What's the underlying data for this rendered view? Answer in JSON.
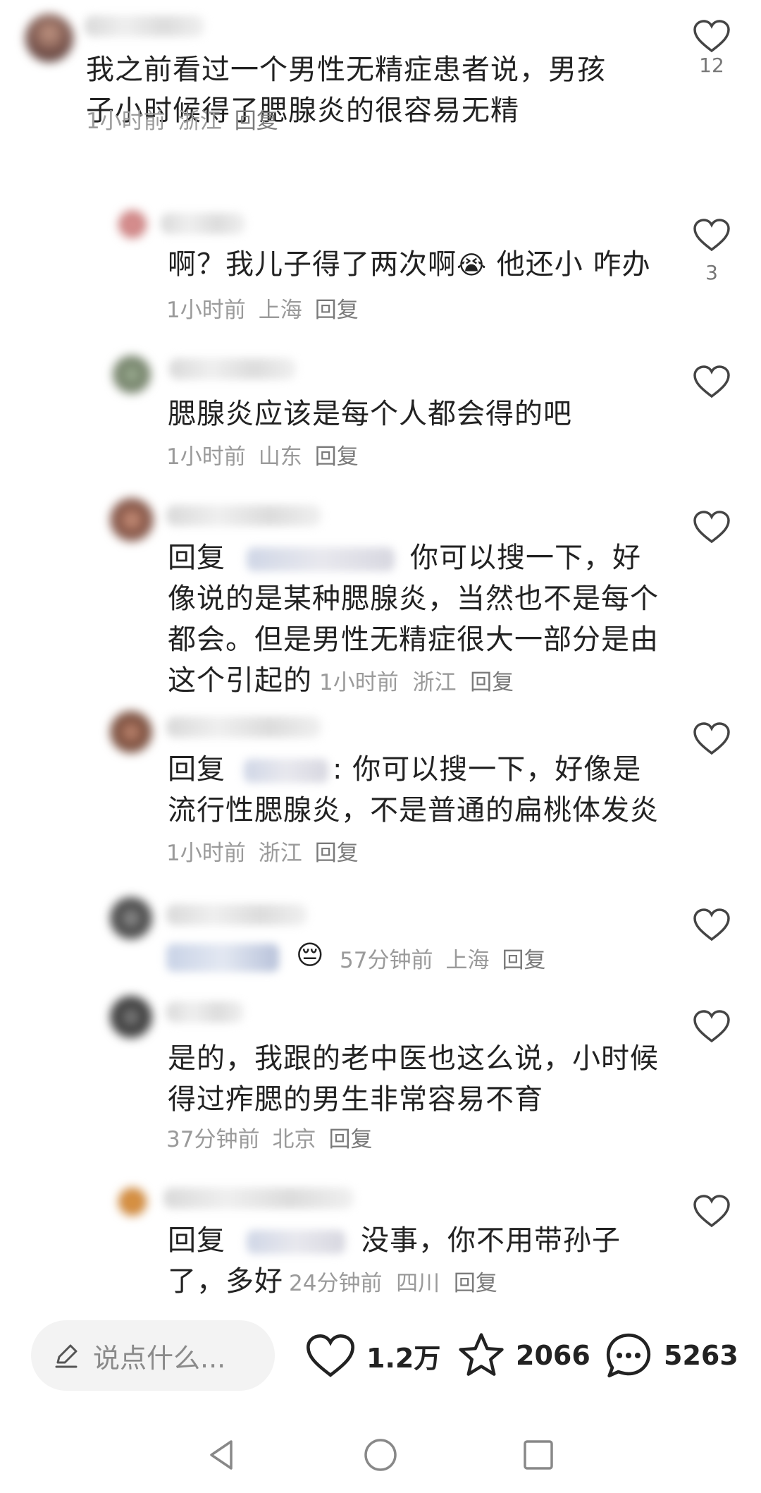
{
  "comments": [
    {
      "text": "我之前看过一个男性无精症患者说，男孩子小时候得了腮腺炎的很容易无精",
      "line1": "我之前看过一个男性无精症患者说，男孩",
      "line2": "子小时候得了腮腺炎的很容易无精",
      "time": "1小时前",
      "location": "浙江",
      "reply": "回复",
      "likes": "12"
    },
    {
      "text": "啊？我儿子得了两次啊😭 他还小 咋办",
      "line1a": "啊？我儿子得了两次啊",
      "emoji": "😭",
      "line1b": " 他还小 咋办",
      "time": "1小时前",
      "location": "上海",
      "reply": "回复",
      "likes": "3"
    },
    {
      "line1": "腮腺炎应该是每个人都会得的吧",
      "time": "1小时前",
      "location": "山东",
      "reply": "回复"
    },
    {
      "prefix": "回复",
      "line1": "你可以搜一下，好",
      "line2": "像说的是某种腮腺炎，当然也不是每个",
      "line3": "都会。但是男性无精症很大一部分是由",
      "line4": "这个引起的",
      "time": "1小时前",
      "location": "浙江",
      "reply": "回复"
    },
    {
      "prefix": "回复",
      "line1": ": 你可以搜一下，好像是",
      "line2": "流行性腮腺炎，不是普通的扁桃体发炎",
      "time": "1小时前",
      "location": "浙江",
      "reply": "回复"
    },
    {
      "time": "57分钟前",
      "location": "上海",
      "reply": "回复",
      "emoji": "😔"
    },
    {
      "line1": "是的，我跟的老中医也这么说，小时候",
      "line2": "得过痄腮的男生非常容易不育",
      "time": "37分钟前",
      "location": "北京",
      "reply": "回复"
    },
    {
      "prefix": "回复",
      "line1": "没事，你不用带孙子",
      "line2": "了，多好",
      "time": "24分钟前",
      "location": "四川",
      "reply": "回复"
    }
  ],
  "bottom": {
    "placeholder": "说点什么...",
    "likes": "1.2万",
    "favorites": "2066",
    "comments": "5263"
  }
}
